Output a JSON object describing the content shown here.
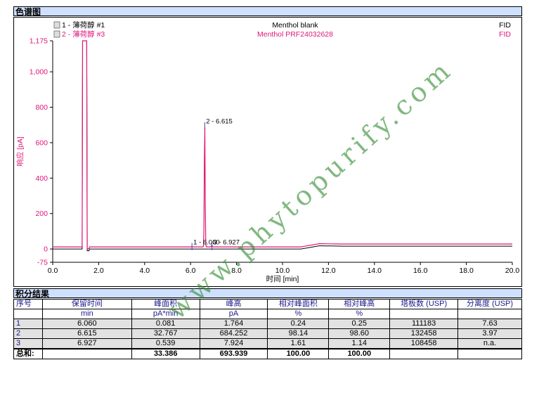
{
  "section_chromatogram": "色谱图",
  "section_results": "积分结果",
  "chart_data": {
    "type": "line",
    "xlabel": "时间 [min]",
    "ylabel": "响应 [pA]",
    "xlim": [
      0,
      20
    ],
    "ylim": [
      -75,
      1175
    ],
    "xticks": [
      "0.0",
      "2.0",
      "4.0",
      "6.0",
      "8.0",
      "10.0",
      "12.0",
      "14.0",
      "16.0",
      "18.0",
      "20.0"
    ],
    "yticks": [
      "-75",
      "0",
      "200",
      "400",
      "600",
      "800",
      "1,000",
      "1,175"
    ],
    "series": [
      {
        "name": "1 - 薄荷醇 #1",
        "sample": "Menthol blank",
        "detector": "FID",
        "color": "#000000"
      },
      {
        "name": "2 - 薄荷醇 #3",
        "sample": "Menthol PRF24032628",
        "detector": "FID",
        "color": "#e0157a"
      }
    ],
    "annotations": [
      {
        "text": "1 - 6.060",
        "x": 6.06,
        "y": 18
      },
      {
        "text": "2 - 6.615",
        "x": 6.615,
        "y": 700
      },
      {
        "text": "3 - 6.927",
        "x": 6.927,
        "y": 18
      }
    ]
  },
  "table": {
    "headers": [
      "序号",
      "保留时间",
      "峰面积",
      "峰高",
      "相对峰面积",
      "相对峰高",
      "塔板数 (USP)",
      "分离度 (USP)"
    ],
    "units": [
      "",
      "min",
      "pA*min",
      "pA",
      "%",
      "%",
      "",
      ""
    ],
    "rows": [
      [
        "1",
        "6.060",
        "0.081",
        "1.764",
        "0.24",
        "0.25",
        "111183",
        "7.63"
      ],
      [
        "2",
        "6.615",
        "32.767",
        "684.252",
        "98.14",
        "98.60",
        "132458",
        "3.97"
      ],
      [
        "3",
        "6.927",
        "0.539",
        "7.924",
        "1.61",
        "1.14",
        "108458",
        "n.a."
      ]
    ],
    "total": [
      "总和:",
      "",
      "33.386",
      "693.939",
      "100.00",
      "100.00",
      "",
      ""
    ]
  },
  "watermark": "www.phytopurify.com"
}
